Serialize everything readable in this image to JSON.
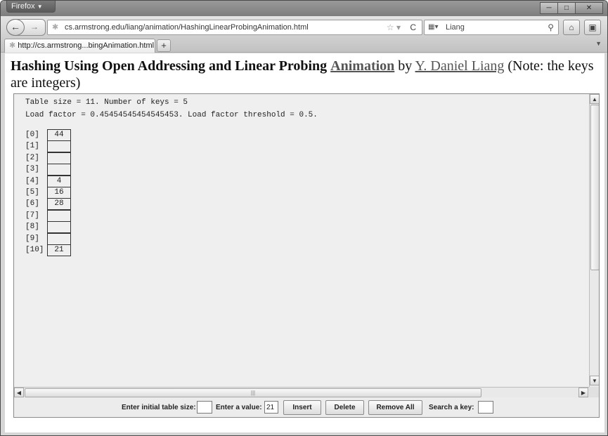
{
  "browser": {
    "app_button_label": "Firefox",
    "url": "cs.armstrong.edu/liang/animation/HashingLinearProbingAnimation.html",
    "search_engine_label": "Liang",
    "tab_title": "http://cs.armstrong...bingAnimation.html",
    "new_tab_label": "+"
  },
  "page": {
    "heading_bold": "Hashing Using Open Addressing and Linear Probing",
    "animation_link": "Animation",
    "by_text": " by ",
    "author_link": "Y. Daniel Liang",
    "note_text": " (Note: the keys are integers)"
  },
  "applet": {
    "info_line_1": "Table size = 11. Number of keys = 5",
    "info_line_2": "Load factor = 0.45454545454545453. Load factor threshold = 0.5.",
    "table": [
      {
        "index": "[0]",
        "value": "44"
      },
      {
        "index": "[1]",
        "value": ""
      },
      {
        "index": "[2]",
        "value": ""
      },
      {
        "index": "[3]",
        "value": ""
      },
      {
        "index": "[4]",
        "value": "4"
      },
      {
        "index": "[5]",
        "value": "16"
      },
      {
        "index": "[6]",
        "value": "28"
      },
      {
        "index": "[7]",
        "value": ""
      },
      {
        "index": "[8]",
        "value": ""
      },
      {
        "index": "[9]",
        "value": ""
      },
      {
        "index": "[10]",
        "value": "21"
      }
    ],
    "controls": {
      "initial_size_label": "Enter initial table size:",
      "initial_size_value": "",
      "value_label": "Enter a value:",
      "value_value": "21",
      "insert_label": "Insert",
      "delete_label": "Delete",
      "remove_all_label": "Remove All",
      "search_label": "Search a key:",
      "search_value": ""
    }
  }
}
